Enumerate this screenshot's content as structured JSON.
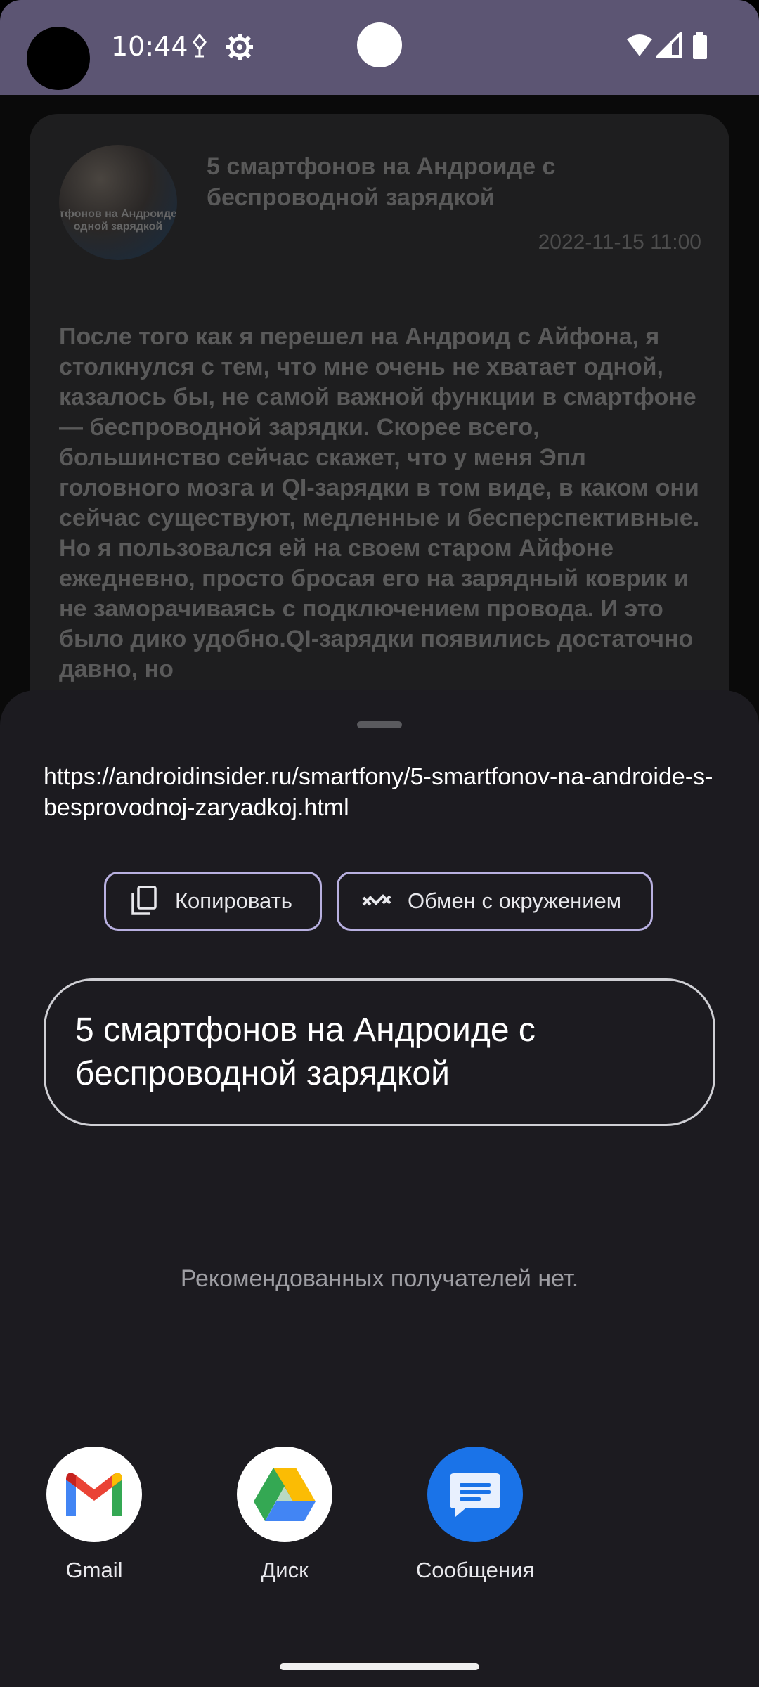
{
  "status_bar": {
    "time": "10:44",
    "icons": [
      "location-icon",
      "settings-gear-icon",
      "wifi-icon",
      "signal-icon",
      "battery-icon"
    ]
  },
  "article": {
    "thumbnail_text": "тфонов на Андроиде с\nодной зарядкой",
    "title": "5 смартфонов на Андроиде с беспроводной зарядкой",
    "date": "2022-11-15 11:00",
    "body": "После того как я перешел на Андроид с Айфона, я столкнулся с тем, что мне очень не хватает одной, казалось бы, не самой важной функции в смартфоне — беспроводной зарядки. Скорее всего, большинство сейчас скажет, что у меня Эпл головного мозга и QI-зарядки в том виде, в каком они сейчас существуют, медленные и бесперспективные. Но я пользовался ей на своем старом Айфоне ежедневно, просто бросая его на зарядный коврик и не заморачиваясь с подключением провода. И это было дико удобно.QI-зарядки появились достаточно давно, но"
  },
  "share_sheet": {
    "url": "https://androidinsider.ru/smartfony/5-smartfonov-na-androide-s-besprovodnoj-zaryadkoj.html",
    "copy_label": "Копировать",
    "nearby_label": "Обмен с окружением",
    "title": "5 смартфонов на Андроиде с беспроводной зарядкой",
    "no_recipients": "Рекомендованных получателей нет.",
    "apps": [
      {
        "label": "Gmail",
        "icon": "gmail-icon"
      },
      {
        "label": "Диск",
        "icon": "google-drive-icon"
      },
      {
        "label": "Сообщения",
        "icon": "messages-icon"
      }
    ]
  },
  "colors": {
    "status_bar": "#5c5573",
    "sheet_bg": "#1c1b20",
    "chip_border": "#b8b0e0",
    "messages_blue": "#1a73e8"
  }
}
